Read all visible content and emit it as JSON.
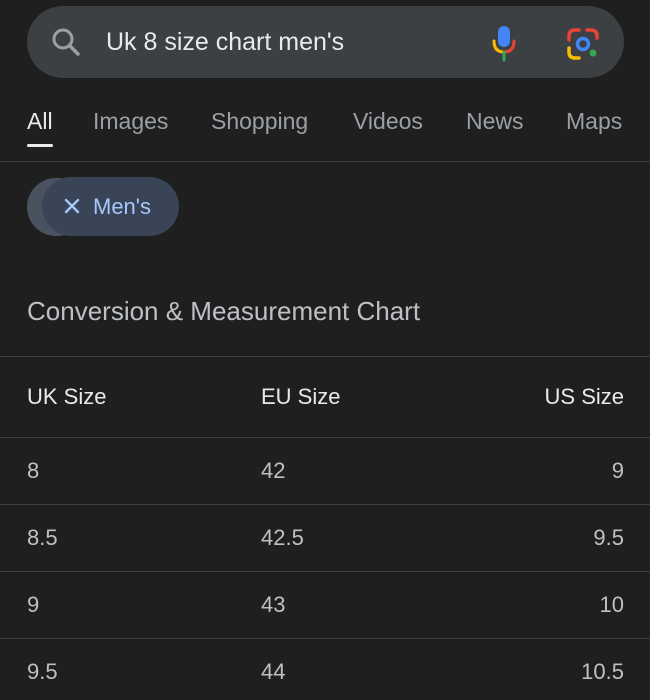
{
  "search": {
    "query": "Uk 8 size chart men's"
  },
  "tabs": [
    {
      "label": "All",
      "active": true
    },
    {
      "label": "Images",
      "active": false
    },
    {
      "label": "Shopping",
      "active": false
    },
    {
      "label": "Videos",
      "active": false
    },
    {
      "label": "News",
      "active": false
    },
    {
      "label": "Maps",
      "active": false
    }
  ],
  "filter_chip": {
    "label": "Men's",
    "icon": "close-icon"
  },
  "section": {
    "title": "Conversion & Measurement Chart"
  },
  "table": {
    "headers": [
      "UK Size",
      "EU Size",
      "US Size"
    ],
    "rows": [
      [
        "8",
        "42",
        "9"
      ],
      [
        "8.5",
        "42.5",
        "9.5"
      ],
      [
        "9",
        "43",
        "10"
      ],
      [
        "9.5",
        "44",
        "10.5"
      ]
    ]
  },
  "colors": {
    "background": "#1f1f1f",
    "search_bar": "#3c4043",
    "chip_background": "#394457",
    "chip_text": "#a8c7fa",
    "divider": "#3c4043"
  }
}
